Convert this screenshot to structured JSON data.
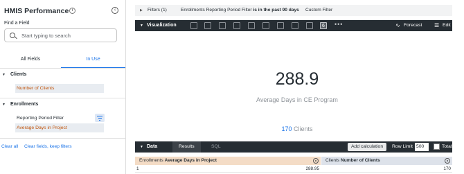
{
  "sidebar": {
    "title": "HMIS Performance",
    "find_label": "Find a Field",
    "search_placeholder": "Start typing to search",
    "tabs": [
      "All Fields",
      "In Use"
    ],
    "groups": [
      {
        "label": "Clients",
        "fields": [
          {
            "label": "Number of Clients",
            "selected": true
          }
        ]
      },
      {
        "label": "Enrollments",
        "fields": [
          {
            "label": "Reporting Period Filter",
            "selected": false,
            "filtered": true
          },
          {
            "label": "Average Days in Project",
            "selected": true
          }
        ]
      }
    ],
    "footer": {
      "clear_all": "Clear all",
      "clear_fields": "Clear fields, keep filters"
    }
  },
  "filters": {
    "title": "Filters (1)",
    "summary_prefix": "Enrollments Reporting Period Filter",
    "summary_condition": "is in the past 90 days",
    "custom": "Custom Filter"
  },
  "visualization": {
    "title": "Visualization",
    "icons": [
      "table-icon",
      "bar-chart-icon",
      "column-chart-icon",
      "scatter-icon",
      "line-chart-icon",
      "area-chart-icon",
      "pie-chart-icon",
      "map-icon",
      "pin-icon",
      "single-value-icon"
    ],
    "active_icon_glyph": "6",
    "more": "•••",
    "forecast": "Forecast",
    "edit": "Edit",
    "kpi": {
      "value": "288.9",
      "label": "Average Days in CE Program",
      "comparison_value": "170",
      "comparison_label": "Clients"
    }
  },
  "data_panel": {
    "title": "Data",
    "tabs": [
      "Results",
      "SQL"
    ],
    "add_calculation": "Add calculation",
    "row_limit_label": "Row Limit",
    "row_limit_value": "500",
    "totals_label": "Totals",
    "columns": [
      {
        "view": "Enrollments",
        "field": "Average Days in Project"
      },
      {
        "view": "Clients",
        "field": "Number of Clients"
      }
    ],
    "rows": [
      {
        "n": "1",
        "values": [
          "288.95",
          "170"
        ]
      }
    ]
  },
  "colors": {
    "dark_bar": "#262d33",
    "accent_blue": "#1a73e8",
    "dimension_orange": "#c1540b",
    "measure_header": "#f4dcc6"
  }
}
